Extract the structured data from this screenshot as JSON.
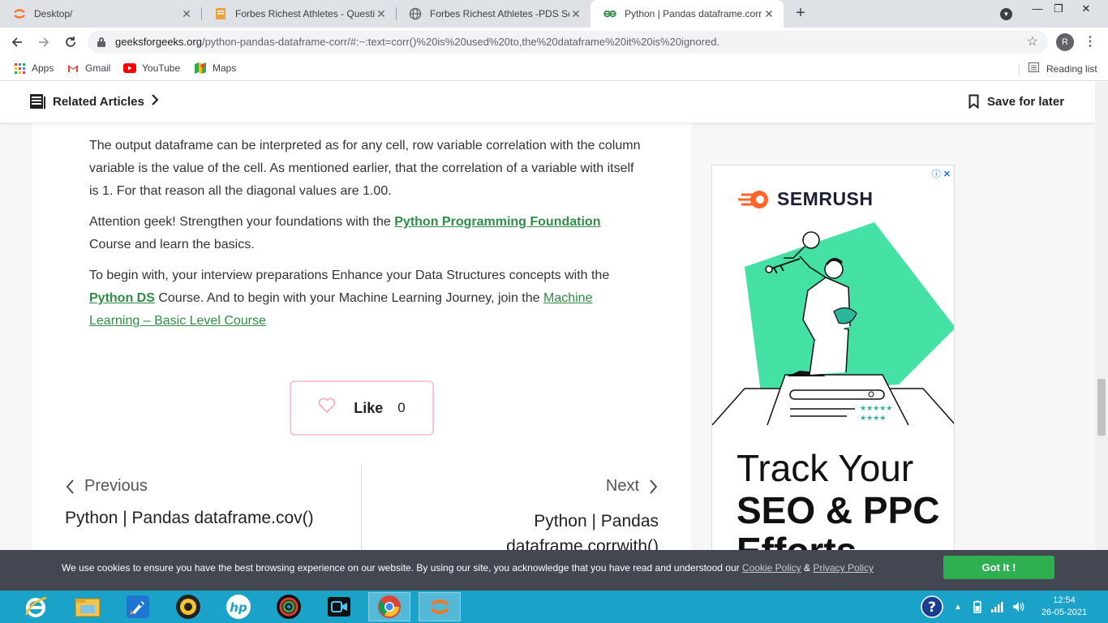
{
  "browser": {
    "tabs": [
      {
        "title": "Desktop/",
        "active": false
      },
      {
        "title": "Forbes Richest Athletes - Questic",
        "active": false
      },
      {
        "title": "Forbes Richest Athletes -PDS Sol",
        "active": false
      },
      {
        "title": "Python | Pandas dataframe.corr()",
        "active": true
      }
    ],
    "url_host": "geeksforgeeks.org",
    "url_path": "/python-pandas-dataframe-corr/#:~:text=corr()%20is%20used%20to,the%20dataframe%20it%20is%20ignored.",
    "profile_initial": "R"
  },
  "bookmarks": {
    "items": [
      "Apps",
      "Gmail",
      "YouTube",
      "Maps"
    ],
    "reading_list": "Reading list"
  },
  "topbar": {
    "related": "Related Articles",
    "save": "Save for later"
  },
  "article": {
    "p1": "The output dataframe can be interpreted as for any cell, row variable correlation with the column variable is the value of the cell. As mentioned earlier, that the correlation of a variable with itself is 1. For that reason all the diagonal values are 1.00.",
    "p2_pre": " Attention geek! Strengthen your foundations with the ",
    "p2_link": "Python Programming Foundation",
    "p2_post": " Course and learn the basics.",
    "p3_pre": "To begin with, your interview preparations Enhance your Data Structures concepts with the ",
    "p3_link1": "Python DS",
    "p3_mid": " Course. And to begin with your Machine Learning Journey, join the ",
    "p3_link2": "Machine Learning – Basic Level Course",
    "like_label": "Like",
    "like_count": "0",
    "prev_label": "Previous",
    "prev_title": "Python | Pandas dataframe.cov()",
    "next_label": "Next",
    "next_title": "Python | Pandas dataframe.corrwith()"
  },
  "ad": {
    "brand": "SEMRUSH",
    "line1": "Track Your",
    "line2": "SEO & PPC",
    "line3": "Efforts"
  },
  "cookie": {
    "text": "We use cookies to ensure you have the best browsing experience on our website. By using our site, you acknowledge that you have read and understood our ",
    "cookie_policy": "Cookie Policy",
    "amp": " & ",
    "privacy_policy": "Privacy Policy",
    "button": "Got It !"
  },
  "taskbar": {
    "time": "12:54",
    "date": "26-05-2021"
  },
  "colors": {
    "gfg_green": "#2f8d46",
    "cookie_bg": "#434751",
    "gotit_green": "#2fb050",
    "taskbar": "#1aa2c8",
    "semrush_orange": "#ff642d",
    "ad_green": "#44e0a4"
  }
}
